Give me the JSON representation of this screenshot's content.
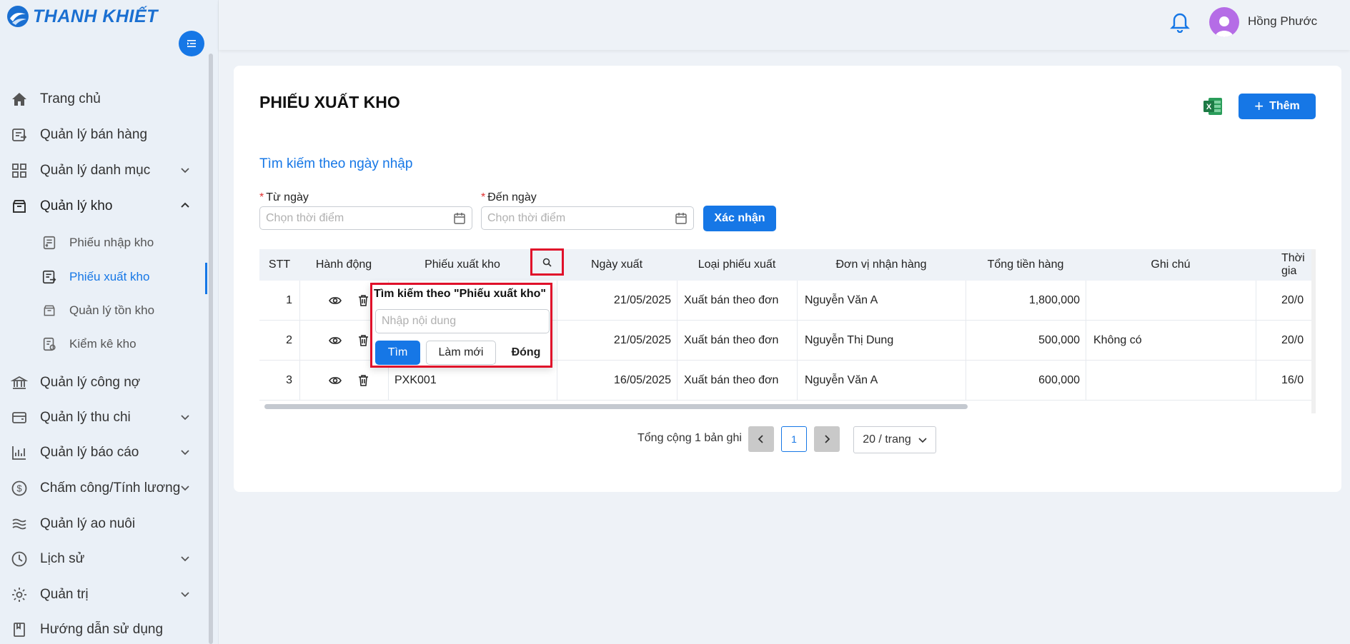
{
  "brand": {
    "name": "THANH KHIẾT"
  },
  "sidebar": {
    "items": [
      {
        "label": "Trang chủ",
        "icon": "home-icon"
      },
      {
        "label": "Quản lý bán hàng",
        "icon": "sales-icon"
      },
      {
        "label": "Quản lý danh mục",
        "icon": "grid-icon",
        "expandable": true
      },
      {
        "label": "Quản lý kho",
        "icon": "warehouse-icon",
        "expandable": true,
        "open": true,
        "children": [
          {
            "label": "Phiếu nhập kho"
          },
          {
            "label": "Phiếu xuất kho",
            "active": true
          },
          {
            "label": "Quản lý tồn kho"
          },
          {
            "label": "Kiểm kê kho"
          }
        ]
      },
      {
        "label": "Quản lý công nợ",
        "icon": "bank-icon"
      },
      {
        "label": "Quản lý thu chi",
        "icon": "wallet-icon",
        "expandable": true
      },
      {
        "label": "Quản lý báo cáo",
        "icon": "report-icon",
        "expandable": true
      },
      {
        "label": "Chấm công/Tính lương",
        "icon": "dollar-icon",
        "expandable": true
      },
      {
        "label": "Quản lý ao nuôi",
        "icon": "waves-icon"
      },
      {
        "label": "Lịch sử",
        "icon": "clock-icon",
        "expandable": true
      },
      {
        "label": "Quản trị",
        "icon": "gear-icon",
        "expandable": true
      },
      {
        "label": "Hướng dẫn sử dụng",
        "icon": "book-icon"
      }
    ]
  },
  "header": {
    "user_name": "Hồng Phước"
  },
  "page": {
    "title": "PHIẾU XUẤT KHO",
    "add_label": "Thêm",
    "search_section": "Tìm kiếm theo ngày nhập",
    "from_label": "Từ ngày",
    "to_label": "Đến ngày",
    "date_placeholder": "Chọn thời điểm",
    "confirm_label": "Xác nhận"
  },
  "table": {
    "columns": [
      "STT",
      "Hành động",
      "Phiếu xuất kho",
      "Ngày xuất",
      "Loại phiếu xuất",
      "Đơn vị nhận hàng",
      "Tổng tiền hàng",
      "Ghi chú",
      "Thời gia"
    ],
    "rows": [
      {
        "stt": "1",
        "code": "",
        "date": "21/05/2025",
        "type": "Xuất bán theo đơn",
        "receiver": "Nguyễn Văn A",
        "total": "1,800,000",
        "note": "",
        "time": "20/0"
      },
      {
        "stt": "2",
        "code": "",
        "date": "21/05/2025",
        "type": "Xuất bán theo đơn",
        "receiver": "Nguyễn Thị Dung",
        "total": "500,000",
        "note": "Không có",
        "time": "20/0"
      },
      {
        "stt": "3",
        "code": "PXK001",
        "date": "16/05/2025",
        "type": "Xuất bán theo đơn",
        "receiver": "Nguyễn Văn A",
        "total": "600,000",
        "note": "",
        "time": "16/0"
      }
    ]
  },
  "popup": {
    "title": "Tìm kiếm theo \"Phiếu xuất kho\"",
    "placeholder": "Nhập nội dung",
    "search_label": "Tìm",
    "reset_label": "Làm mới",
    "close_label": "Đóng"
  },
  "pagination": {
    "total_text": "Tổng cộng 1 bản ghi",
    "current_page": "1",
    "page_size": "20 / trang"
  },
  "colors": {
    "primary": "#1677e6",
    "highlight": "#e0102a",
    "excel": "#1d7a45"
  }
}
